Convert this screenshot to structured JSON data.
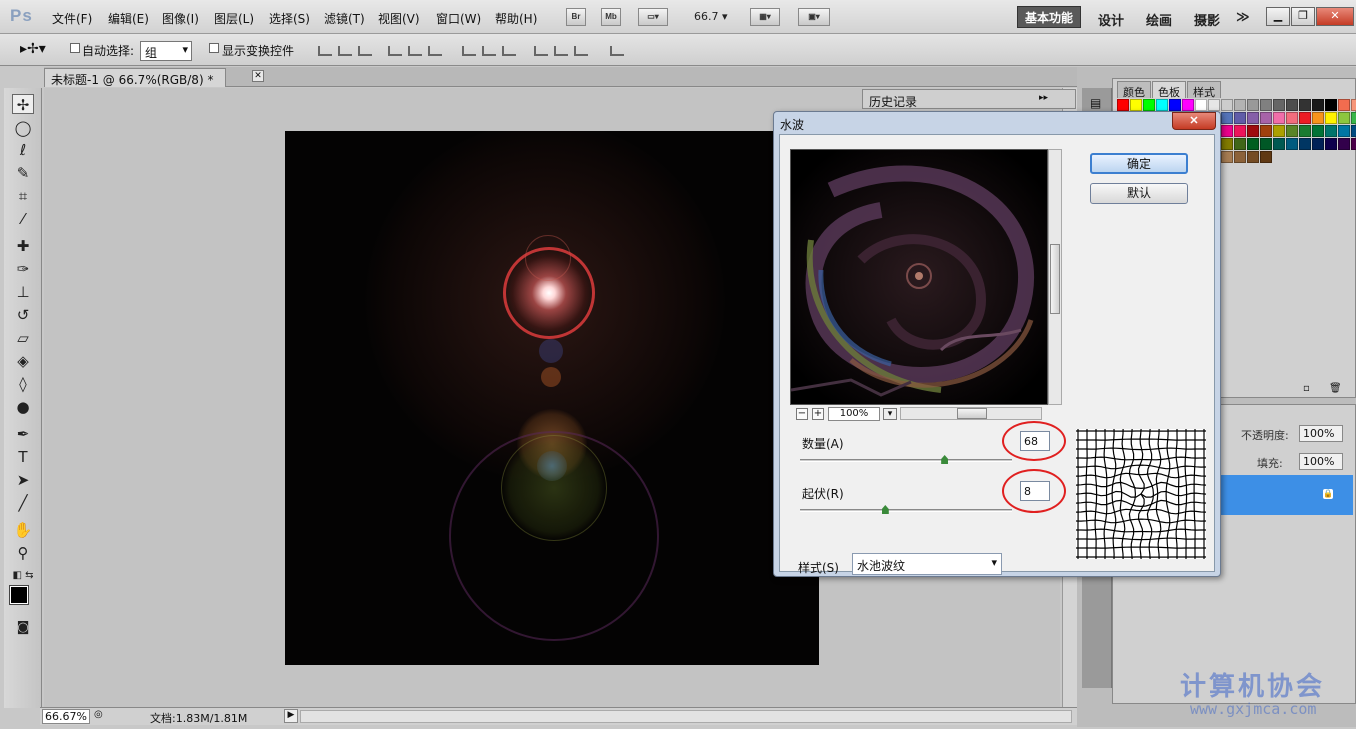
{
  "app": {
    "logo": "Ps"
  },
  "menu": [
    "文件(F)",
    "编辑(E)",
    "图像(I)",
    "图层(L)",
    "选择(S)",
    "滤镜(T)",
    "视图(V)",
    "窗口(W)",
    "帮助(H)"
  ],
  "menubar": {
    "bridge_label": "Br",
    "minibridge_label": "Mb",
    "zoom": "66.7"
  },
  "workspaces": {
    "active": "基本功能",
    "items": [
      "设计",
      "绘画",
      "摄影"
    ],
    "more": "≫"
  },
  "options": {
    "auto_select_label": "自动选择:",
    "auto_select_value": "组",
    "show_transform_label": "显示变换控件"
  },
  "document": {
    "tab_title": "未标题-1 @ 66.7%(RGB/8) *",
    "close": "✕"
  },
  "history_panel": {
    "title": "历史记录"
  },
  "swatch_panel": {
    "tabs": [
      "颜色",
      "色板",
      "样式"
    ],
    "active_tab": "色板",
    "colors": [
      "#ff0000",
      "#ffff00",
      "#00ff00",
      "#00ffff",
      "#0000ff",
      "#ff00ff",
      "#ffffff",
      "#e6e6e6",
      "#cccccc",
      "#b3b3b3",
      "#999999",
      "#808080",
      "#666666",
      "#4d4d4d",
      "#333333",
      "#1a1a1a",
      "#000000",
      "#f26c4f",
      "#f69679",
      "#fbaf5d",
      "#fff799",
      "#acd372",
      "#7cc576",
      "#3bb878",
      "#1abbb4",
      "#00bff3",
      "#438ccb",
      "#5574b9",
      "#605ca8",
      "#855fa8",
      "#a763a8",
      "#f06ea9",
      "#f26d7d",
      "#ed1c24",
      "#f7941d",
      "#fff200",
      "#8dc63f",
      "#39b54a",
      "#00a651",
      "#00a99d",
      "#00aeef",
      "#0072bc",
      "#0054a6",
      "#2e3192",
      "#662d91",
      "#92278f",
      "#ec008c",
      "#ed145b",
      "#9e0b0f",
      "#a0410d",
      "#aba000",
      "#598527",
      "#197b30",
      "#007236",
      "#00746b",
      "#0076a3",
      "#004b80",
      "#003471",
      "#1b1464",
      "#440e62",
      "#630460",
      "#9e005d",
      "#9e0039",
      "#790000",
      "#7b2e00",
      "#827b00",
      "#406618",
      "#005e20",
      "#005826",
      "#005952",
      "#005b7f",
      "#003663",
      "#002157",
      "#0d004c",
      "#32004b",
      "#4b0049",
      "#7b0046",
      "#7a0026",
      "#c7b299",
      "#998675",
      "#736357",
      "#534741",
      "#362f2d",
      "#c69c6d",
      "#a67c52",
      "#8c6239",
      "#754c24",
      "#603913"
    ]
  },
  "layers_panel": {
    "opacity_label": "不透明度:",
    "opacity_value": "100%",
    "fill_label": "填充:",
    "fill_value": "100%"
  },
  "status": {
    "zoom": "66.67%",
    "doc_info": "文档:1.83M/1.81M"
  },
  "dialog": {
    "title": "水波",
    "close": "✕",
    "ok_label": "确定",
    "default_label": "默认",
    "zoom_value": "100%",
    "zoom_out": "−",
    "zoom_in": "+",
    "amount_label": "数量(A)",
    "amount_value": "68",
    "amount_max": 100,
    "ridges_label": "起伏(R)",
    "ridges_value": "8",
    "ridges_max": 20,
    "style_label": "样式(S)",
    "style_value": "水池波纹"
  },
  "watermark": {
    "text": "计算机协会",
    "url": "www.gxjmca.com"
  }
}
